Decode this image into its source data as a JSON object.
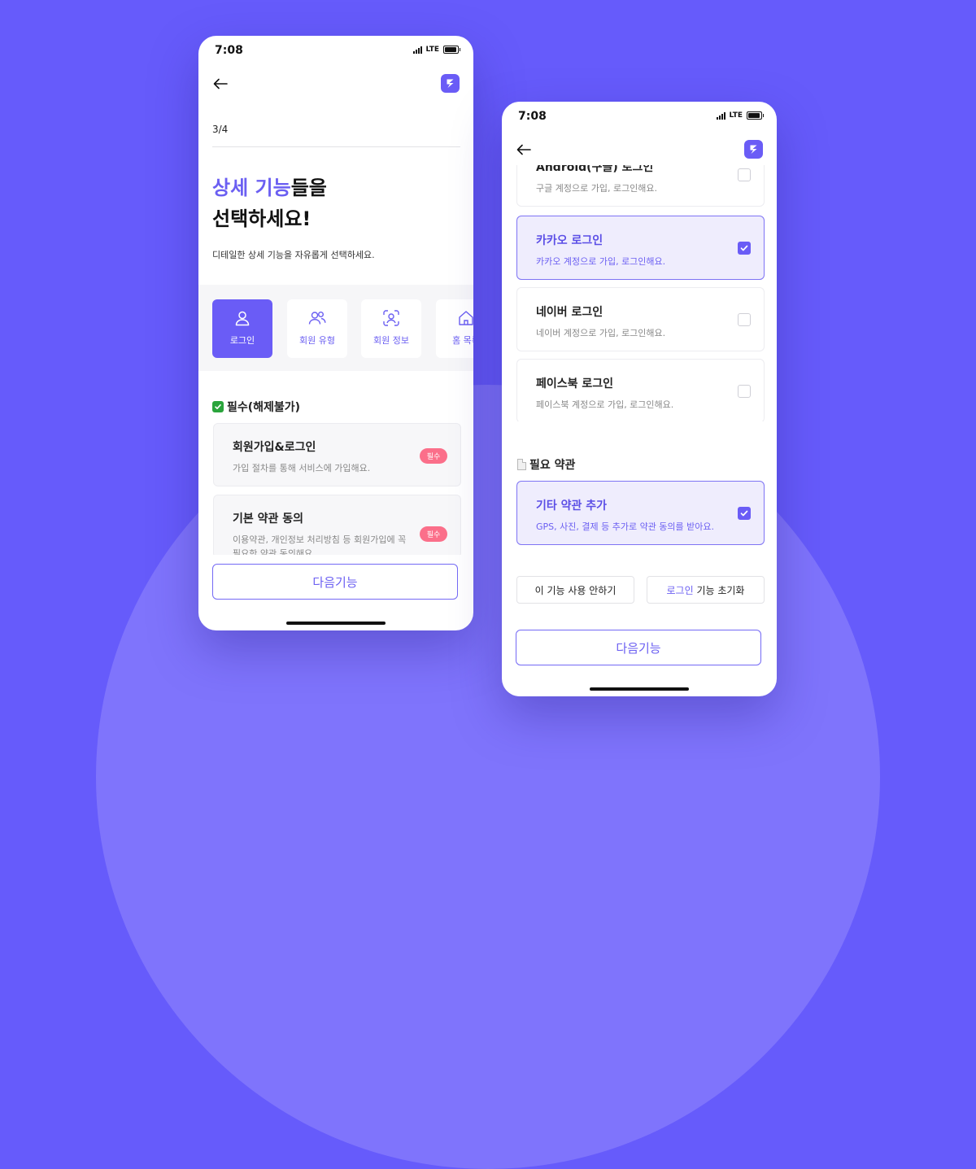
{
  "phone1": {
    "status": {
      "time": "7:08",
      "network": "LTE"
    },
    "step": "3/4",
    "heading": {
      "highlight": "상세 기능",
      "rest": "들을",
      "line2": "선택하세요!"
    },
    "subtitle": "디테일한 상세 기능을 자유롭게 선택하세요.",
    "categories": [
      {
        "label": "로그인",
        "icon": "person-icon",
        "active": true
      },
      {
        "label": "회원 유형",
        "icon": "users-icon",
        "active": false
      },
      {
        "label": "회원 정보",
        "icon": "face-scan-icon",
        "active": false
      },
      {
        "label": "홈 목록",
        "icon": "home-icon",
        "active": false
      }
    ],
    "section_title": "필수(해제불가)",
    "items": [
      {
        "title": "회원가입&로그인",
        "desc": "가입 절차를 통해 서비스에 가입해요.",
        "badge": "필수"
      },
      {
        "title": "기본 약관 동의",
        "desc": "이용약관, 개인정보 처리방침 등 회원가입에 꼭 필요한 약관 동의해요",
        "badge": "필수"
      }
    ],
    "next_label": "다음기능"
  },
  "phone2": {
    "status": {
      "time": "7:08",
      "network": "LTE"
    },
    "options": [
      {
        "title": "Android(구글) 로그인",
        "desc": "구글 계정으로 가입, 로그인해요.",
        "checked": false
      },
      {
        "title": "카카오 로그인",
        "desc": "카카오 계정으로 가입, 로그인해요.",
        "checked": true
      },
      {
        "title": "네이버 로그인",
        "desc": "네이버 계정으로 가입, 로그인해요.",
        "checked": false
      },
      {
        "title": "페이스북 로그인",
        "desc": "페이스북 계정으로 가입, 로그인해요.",
        "checked": false
      }
    ],
    "terms_section": "필요 약관",
    "terms_item": {
      "title": "기타 약관 추가",
      "desc": "GPS, 사진, 결제 등 추가로 약관 동의를 받아요.",
      "checked": true
    },
    "disable_label": "이 기능 사용 안하기",
    "reset": {
      "highlight": "로그인",
      "rest": " 기능 초기화"
    },
    "next_label": "다음기능"
  },
  "colors": {
    "background": "#665bfb",
    "accent": "#6a5cf6",
    "badge": "#fb6f8a",
    "selected_card": "#efedfd"
  }
}
